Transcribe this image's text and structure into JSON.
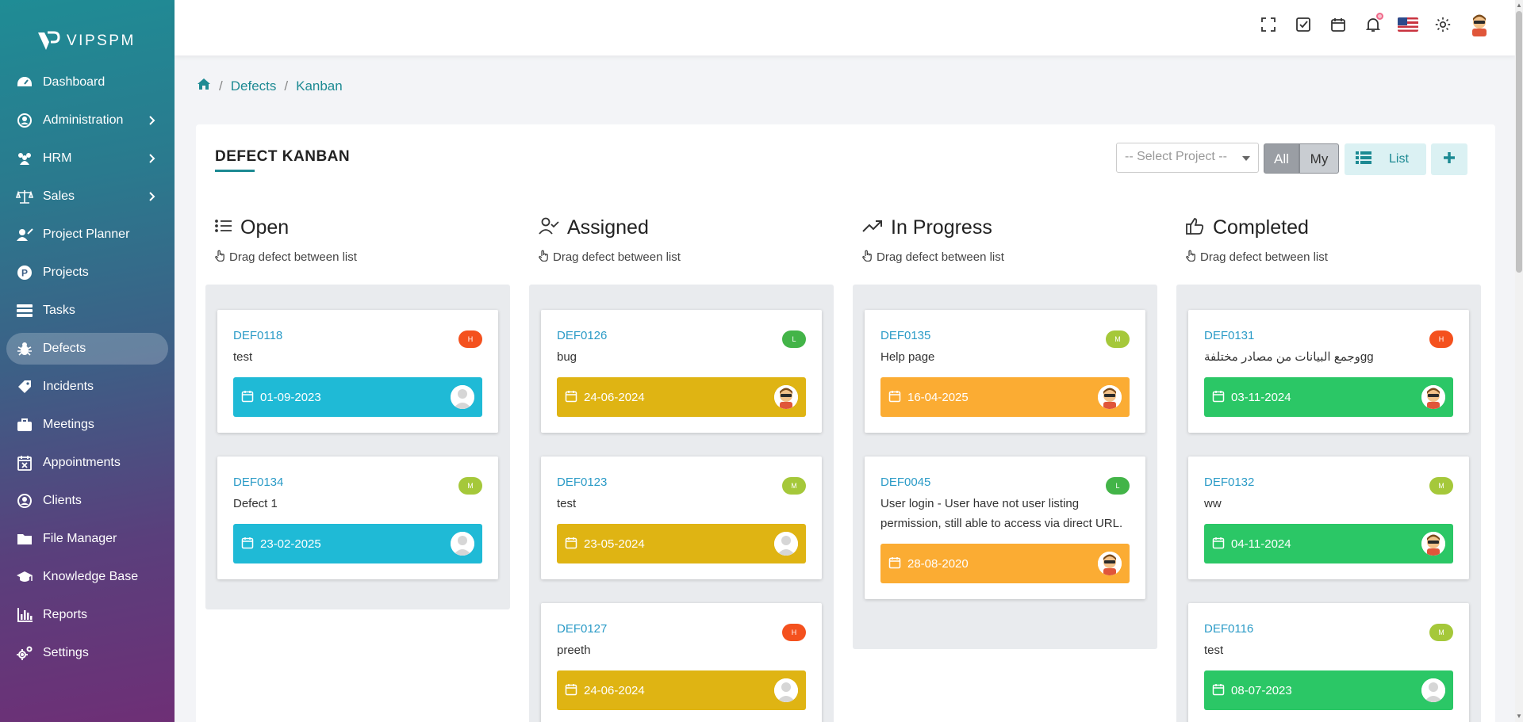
{
  "app": {
    "logo_text": "VIPSPM"
  },
  "sidebar": {
    "items": [
      {
        "label": "Dashboard",
        "icon": "dashboard-icon",
        "chevron": false,
        "active": false
      },
      {
        "label": "Administration",
        "icon": "user-circle-icon",
        "chevron": true,
        "active": false
      },
      {
        "label": "HRM",
        "icon": "users-icon",
        "chevron": true,
        "active": false
      },
      {
        "label": "Sales",
        "icon": "scale-icon",
        "chevron": true,
        "active": false
      },
      {
        "label": "Project Planner",
        "icon": "project-planner-icon",
        "chevron": false,
        "active": false
      },
      {
        "label": "Projects",
        "icon": "p-circle-icon",
        "chevron": false,
        "active": false
      },
      {
        "label": "Tasks",
        "icon": "tasks-icon",
        "chevron": false,
        "active": false
      },
      {
        "label": "Defects",
        "icon": "bug-icon",
        "chevron": false,
        "active": true
      },
      {
        "label": "Incidents",
        "icon": "tag-icon",
        "chevron": false,
        "active": false
      },
      {
        "label": "Meetings",
        "icon": "briefcase-icon",
        "chevron": false,
        "active": false
      },
      {
        "label": "Appointments",
        "icon": "calendar-x-icon",
        "chevron": false,
        "active": false
      },
      {
        "label": "Clients",
        "icon": "client-icon",
        "chevron": false,
        "active": false
      },
      {
        "label": "File Manager",
        "icon": "folder-icon",
        "chevron": false,
        "active": false
      },
      {
        "label": "Knowledge Base",
        "icon": "graduation-cap-icon",
        "chevron": false,
        "active": false
      },
      {
        "label": "Reports",
        "icon": "bar-chart-icon",
        "chevron": false,
        "active": false
      },
      {
        "label": "Settings",
        "icon": "cogs-icon",
        "chevron": false,
        "active": false
      }
    ]
  },
  "topbar": {
    "icons": [
      "fullscreen-icon",
      "checkbox-icon",
      "calendar-icon",
      "bell-icon",
      "us-flag-icon",
      "gear-icon",
      "user-avatar-icon"
    ]
  },
  "breadcrumb": {
    "home_icon": "home-icon",
    "items": [
      "Defects",
      "Kanban"
    ],
    "separator": "/"
  },
  "page": {
    "title": "DEFECT KANBAN",
    "select_project_placeholder": "-- Select Project --",
    "toggle_all": "All",
    "toggle_my": "My",
    "list_button": "List"
  },
  "colors": {
    "accent": "#1d8a93",
    "priority_H": "#f4511e",
    "priority_M": "#a5c83a",
    "priority_L": "#43b448",
    "open": "#1fbad6",
    "assigned": "#dfb413",
    "in_progress": "#fbac33",
    "completed": "#2bc766"
  },
  "columns": [
    {
      "title": "Open",
      "icon": "list-icon",
      "hint": "Drag defect between list",
      "color": "#1fbad6",
      "cards": [
        {
          "code": "DEF0118",
          "desc": "test",
          "priority": "H",
          "date": "01-09-2023",
          "avatar": "blank"
        },
        {
          "code": "DEF0134",
          "desc": "Defect 1",
          "priority": "M",
          "date": "23-02-2025",
          "avatar": "blank"
        }
      ]
    },
    {
      "title": "Assigned",
      "icon": "user-check-icon",
      "hint": "Drag defect between list",
      "color": "#dfb413",
      "cards": [
        {
          "code": "DEF0126",
          "desc": "bug",
          "priority": "L",
          "date": "24-06-2024",
          "avatar": "face"
        },
        {
          "code": "DEF0123",
          "desc": "test",
          "priority": "M",
          "date": "23-05-2024",
          "avatar": "blank"
        },
        {
          "code": "DEF0127",
          "desc": "preeth",
          "priority": "H",
          "date": "24-06-2024",
          "avatar": "blank"
        }
      ]
    },
    {
      "title": "In Progress",
      "icon": "trending-up-icon",
      "hint": "Drag defect between list",
      "color": "#fbac33",
      "cards": [
        {
          "code": "DEF0135",
          "desc": "Help page",
          "priority": "M",
          "date": "16-04-2025",
          "avatar": "face"
        },
        {
          "code": "DEF0045",
          "desc": "User login - User have not user listing permission, still able to access via direct URL.",
          "priority": "L",
          "date": "28-08-2020",
          "avatar": "face"
        }
      ]
    },
    {
      "title": "Completed",
      "icon": "thumbs-up-icon",
      "hint": "Drag defect between list",
      "color": "#2bc766",
      "cards": [
        {
          "code": "DEF0131",
          "desc": "وجمع البيانات من مصادر مختلفةgg",
          "priority": "H",
          "date": "03-11-2024",
          "avatar": "face"
        },
        {
          "code": "DEF0132",
          "desc": "ww",
          "priority": "M",
          "date": "04-11-2024",
          "avatar": "face"
        },
        {
          "code": "DEF0116",
          "desc": "test",
          "priority": "M",
          "date": "08-07-2023",
          "avatar": "blank"
        }
      ]
    }
  ]
}
